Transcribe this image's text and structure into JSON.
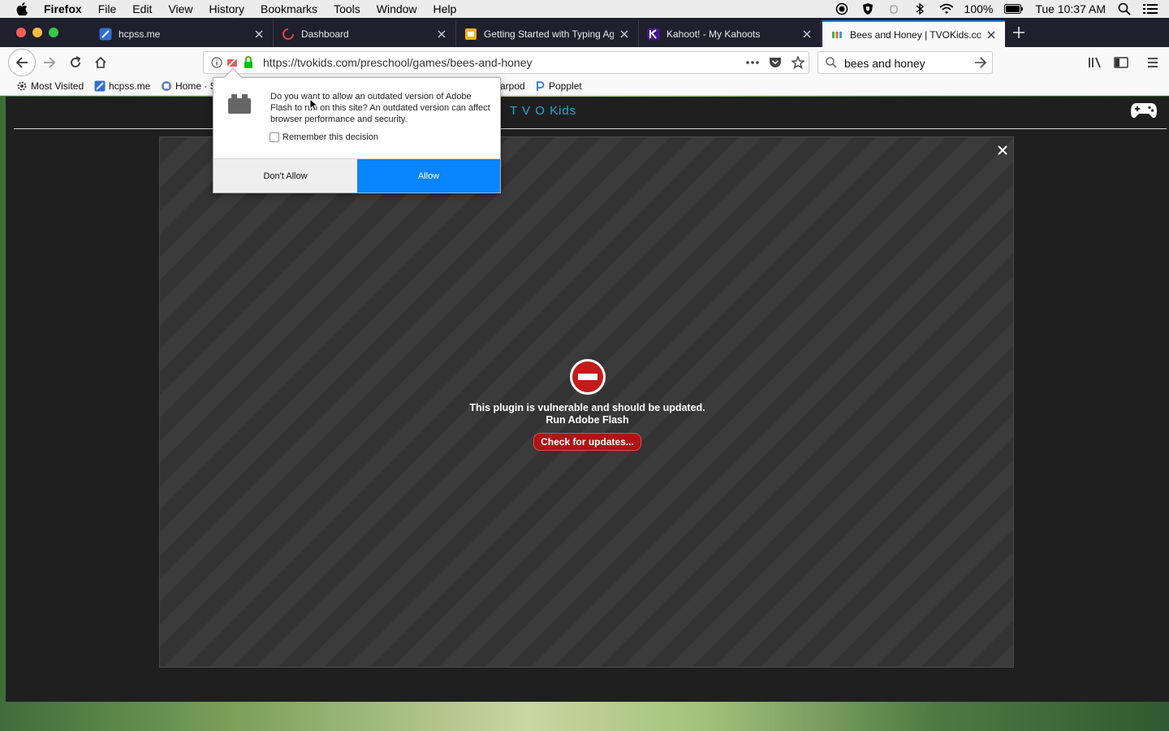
{
  "menubar": {
    "app_name": "Firefox",
    "items": [
      "File",
      "Edit",
      "View",
      "History",
      "Bookmarks",
      "Tools",
      "Window",
      "Help"
    ],
    "battery": "100%",
    "clock": "Tue 10:37 AM"
  },
  "tabs": [
    {
      "label": "hcpss.me",
      "icon": "hcpss-favicon"
    },
    {
      "label": "Dashboard",
      "icon": "loading-favicon"
    },
    {
      "label": "Getting Started with Typing Ag",
      "icon": "slides-favicon"
    },
    {
      "label": "Kahoot! - My Kahoots",
      "icon": "kahoot-favicon"
    },
    {
      "label": "Bees and Honey | TVOKids.com",
      "icon": "tvokids-favicon"
    }
  ],
  "navbar": {
    "url": "https://tvokids.com/preschool/games/bees-and-honey",
    "search_value": "bees and honey"
  },
  "bookmarks": [
    {
      "label": "Most Visited"
    },
    {
      "label": "hcpss.me"
    },
    {
      "label": "Home · S"
    },
    {
      "label": "arpod"
    },
    {
      "label": "Popplet"
    }
  ],
  "site": {
    "logo": "T V O Kids"
  },
  "plugin": {
    "line1": "This plugin is vulnerable and should be updated.",
    "line2": "Run Adobe Flash",
    "update_label": "Check for updates..."
  },
  "popup": {
    "message": "Do you want to allow an outdated version of Adobe Flash to run on this site? An outdated version can affect browser performance and security.",
    "remember_label": "Remember this decision",
    "deny_label": "Don't Allow",
    "allow_label": "Allow"
  },
  "colors": {
    "accent": "#0a84ff",
    "danger": "#b01313",
    "logo": "#2aa6d8"
  }
}
